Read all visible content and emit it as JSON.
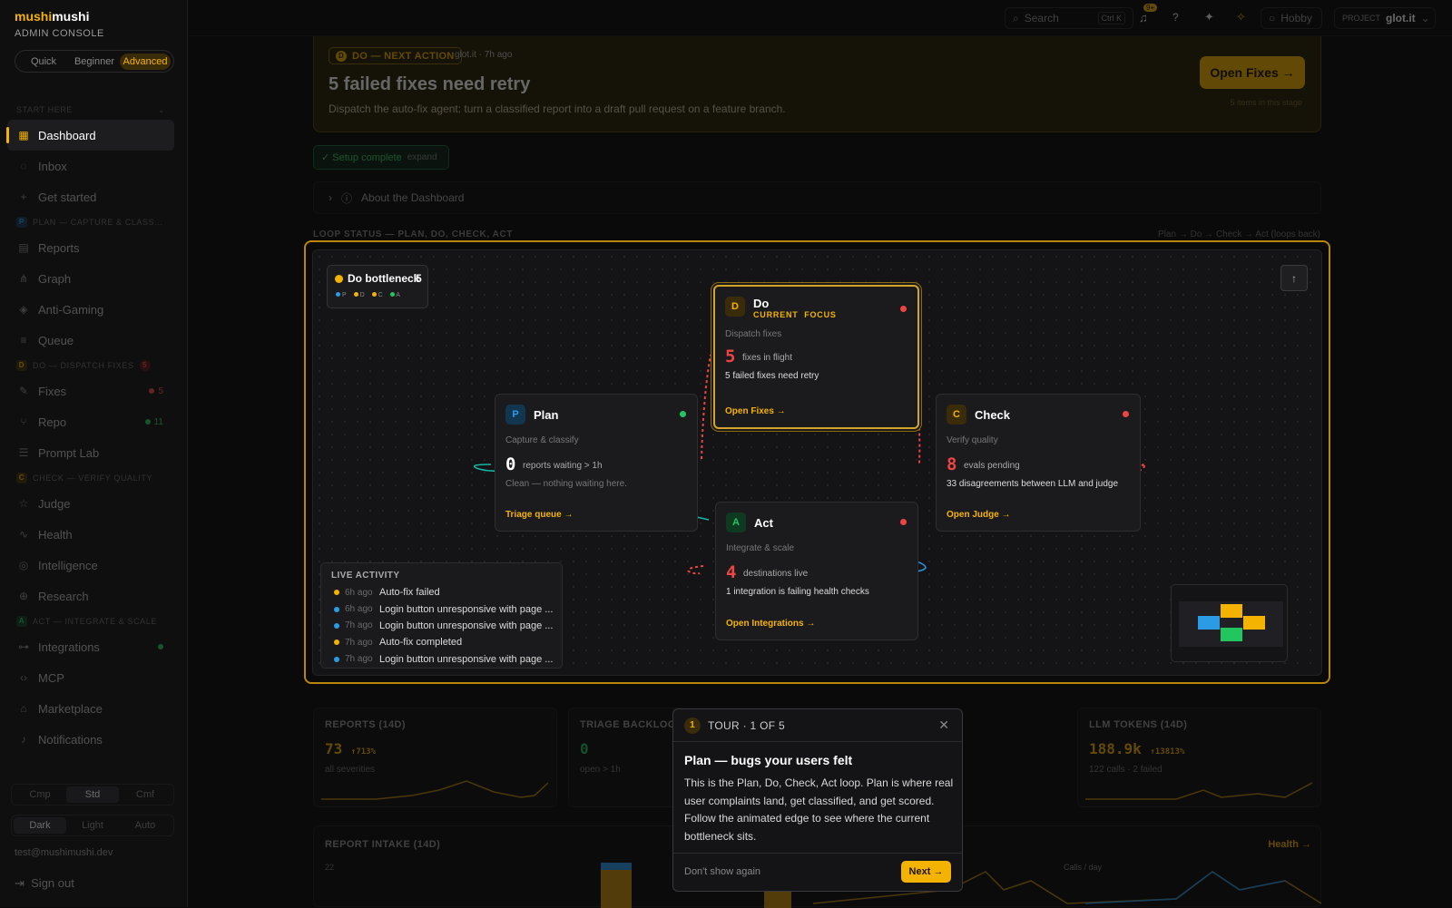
{
  "brand": {
    "name_a": "mushi",
    "name_b": "mushi",
    "subtitle": "ADMIN CONSOLE",
    "modes": [
      "Quick",
      "Beginner",
      "Advanced"
    ],
    "active_mode": "Advanced"
  },
  "sidebar": {
    "start_label": "START HERE",
    "dashboard": "Dashboard",
    "inbox": "Inbox",
    "get_started": "Get started",
    "plan_section": "PLAN — CAPTURE & CLASS…",
    "reports": "Reports",
    "graph": "Graph",
    "anti_gaming": "Anti-Gaming",
    "queue": "Queue",
    "do_section": "DO — DISPATCH FIXES",
    "do_count": "5",
    "fixes": "Fixes",
    "fixes_count": "5",
    "repo": "Repo",
    "repo_count": "11",
    "prompt_lab": "Prompt Lab",
    "check_section": "CHECK — VERIFY QUALITY",
    "judge": "Judge",
    "health": "Health",
    "intelligence": "Intelligence",
    "research": "Research",
    "act_section": "ACT — INTEGRATE & SCALE",
    "integrations": "Integrations",
    "mcp": "MCP",
    "marketplace": "Marketplace",
    "notifications": "Notifications",
    "density": [
      "Cmp",
      "Std",
      "Cmf"
    ],
    "density_active": "Std",
    "theme": [
      "Dark",
      "Light",
      "Auto"
    ],
    "theme_active": "Dark",
    "email": "test@mushimushi.dev",
    "sign_out": "Sign out"
  },
  "topbar": {
    "search": "Search",
    "shortcut": "Ctrl K",
    "notif_count": "9+",
    "help": "?",
    "plan": "Hobby",
    "project_label": "PROJECT",
    "project": "glot.it"
  },
  "banner": {
    "pill": "DO — NEXT ACTION",
    "project": "glot.it",
    "age": "7h ago",
    "title": "5 failed fixes need retry",
    "desc": "Dispatch the auto-fix agent: turn a classified report into a draft pull request on a feature branch.",
    "cta": "Open Fixes →",
    "cta_sub": "5 items in this stage"
  },
  "setup": {
    "label": "✓ Setup complete",
    "action": "expand"
  },
  "about": {
    "label": "About the Dashboard"
  },
  "loop": {
    "label": "LOOP STATUS — PLAN, DO, CHECK, ACT",
    "flow": "Plan → Do → Check → Act (loops back)",
    "bottleneck": {
      "label": "Do bottleneck",
      "count": "5",
      "legend": [
        "P",
        "D",
        "C",
        "A"
      ]
    },
    "plan": {
      "badge": "P",
      "title": "Plan",
      "sub": "Capture & classify",
      "num": "0",
      "unit": "reports waiting > 1h",
      "desc": "Clean — nothing waiting here.",
      "link": "Triage queue →"
    },
    "do": {
      "badge": "D",
      "title": "Do",
      "focus": "CURRENT  FOCUS",
      "sub": "Dispatch fixes",
      "num": "5",
      "unit": "fixes in flight",
      "desc": "5 failed fixes need retry",
      "link": "Open Fixes →"
    },
    "check": {
      "badge": "C",
      "title": "Check",
      "sub": "Verify quality",
      "num": "8",
      "unit": "evals pending",
      "desc": "33 disagreements between LLM and judge",
      "link": "Open Judge →"
    },
    "act": {
      "badge": "A",
      "title": "Act",
      "sub": "Integrate & scale",
      "num": "4",
      "unit": "destinations live",
      "desc": "1 integration is failing health checks",
      "link": "Open Integrations →"
    }
  },
  "live": {
    "title": "LIVE ACTIVITY",
    "rows": [
      {
        "time": "6h ago",
        "text": "Auto-fix failed",
        "color": "#f5b301"
      },
      {
        "time": "6h ago",
        "text": "Login button unresponsive with page ...",
        "color": "#2b9be6"
      },
      {
        "time": "7h ago",
        "text": "Login button unresponsive with page ...",
        "color": "#2b9be6"
      },
      {
        "time": "7h ago",
        "text": "Auto-fix completed",
        "color": "#f5b301"
      },
      {
        "time": "7h ago",
        "text": "Login button unresponsive with page ...",
        "color": "#2b9be6"
      }
    ]
  },
  "stats": {
    "reports": {
      "title": "REPORTS (14D)",
      "value": "73",
      "delta": "↑713%",
      "sub": "all severities"
    },
    "triage": {
      "title": "TRIAGE BACKLOG",
      "value": "0",
      "sub": "open > 1h"
    },
    "tokens": {
      "title": "LLM TOKENS (14D)",
      "value": "188.9k",
      "delta": "↑13813%",
      "sub": "122 calls · 2 failed"
    }
  },
  "intake": {
    "title": "REPORT INTAKE (14D)",
    "axis": "22",
    "health_link": "Health →",
    "calls": "Calls / day"
  },
  "tour": {
    "step": "1",
    "label": "TOUR · 1 OF 5",
    "title": "Plan — bugs your users felt",
    "body": "This is the Plan, Do, Check, Act loop. Plan is where real user complaints land, get classified, and get scored. Follow the animated edge to see where the current bottleneck sits.",
    "dont": "Don't show again",
    "next": "Next →"
  },
  "colors": {
    "accent": "#f5b301",
    "plan": "#2b9be6",
    "do": "#f5b301",
    "check": "#f5b301",
    "act": "#22c55e",
    "danger": "#ef4444",
    "ok": "#22c55e"
  }
}
